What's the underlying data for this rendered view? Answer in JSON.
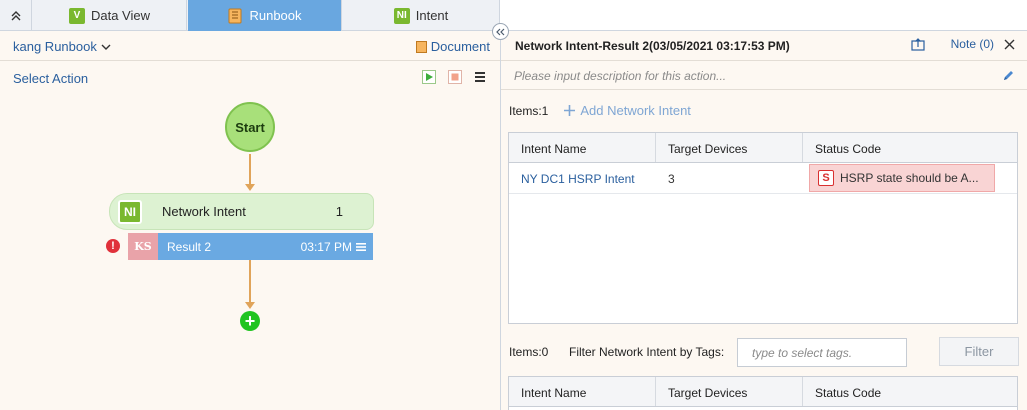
{
  "tabs": {
    "collapse_icon": "double-chevron-up-icon",
    "items": [
      {
        "label": "Data View",
        "icon": "data-view-icon",
        "icon_text": "V",
        "icon_color": "#7ab82f"
      },
      {
        "label": "Runbook",
        "icon": "runbook-icon",
        "icon_text": "",
        "icon_color": "#f0a040"
      },
      {
        "label": "Intent",
        "icon": "intent-icon",
        "icon_text": "NI",
        "icon_color": "#7ab82f"
      }
    ],
    "active": "Runbook"
  },
  "left": {
    "runbook_name": "kang Runbook",
    "document_label": "Document",
    "select_action": "Select Action",
    "flow": {
      "start_label": "Start",
      "node_badge": "NI",
      "node_title": "Network Intent",
      "node_count": "1",
      "result_badge": "KS",
      "result_label": "Result 2",
      "result_time": "03:17 PM",
      "warning": "!",
      "add": "+"
    }
  },
  "right": {
    "title": "Network Intent-Result 2(03/05/2021 03:17:53 PM)",
    "note_label": "Note (0)",
    "description_placeholder": "Please input description for this action...",
    "items_label": "Items:1",
    "add_intent_label": "Add Network Intent",
    "columns": [
      "Intent Name",
      "Target Devices",
      "Status Code"
    ],
    "rows": [
      {
        "name": "NY DC1 HSRP Intent",
        "devices": "3",
        "status_badge": "S",
        "status": "HSRP state should be A..."
      }
    ],
    "filter": {
      "items_label": "Items:0",
      "filter_label": "Filter Network Intent by Tags:",
      "tag_placeholder": "type to select tags.",
      "button": "Filter"
    },
    "columns2": [
      "Intent Name",
      "Target Devices",
      "Status Code"
    ]
  },
  "colors": {
    "accent": "#69a7e0",
    "start_node": "#a8e07a",
    "add_node": "#21c421",
    "error": "#e0313b"
  }
}
